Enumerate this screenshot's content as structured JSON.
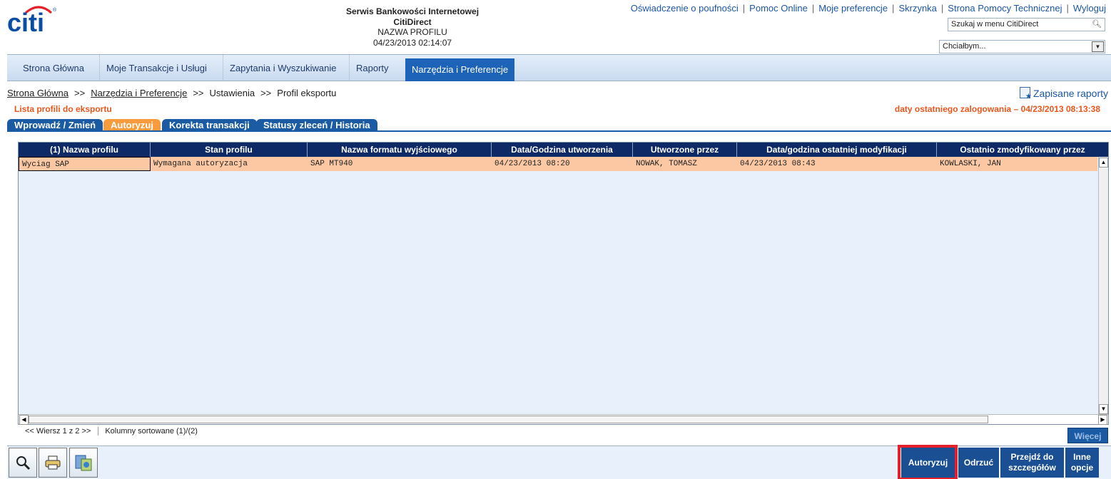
{
  "header": {
    "brand": "citi",
    "service_title": "Serwis Bankowości Internetowej",
    "service_name": "CitiDirect",
    "profile_name": "NAZWA PROFILU",
    "datetime": "04/23/2013 02:14:07",
    "links": [
      "Oświadczenie o poufności",
      "Pomoc Online",
      "Moje preferencje",
      "Skrzynka",
      "Strona Pomocy Technicznej",
      "Wyloguj"
    ],
    "search_placeholder": "Szukaj w menu CitiDirect",
    "want_select": "Chciałbym..."
  },
  "nav": {
    "items": [
      "Strona Główna",
      "Moje Transakcje i Usługi",
      "Zapytania i Wyszukiwanie",
      "Raporty",
      "Narzędzia i Preferencje"
    ],
    "active": "Narzędzia i Preferencje"
  },
  "breadcrumb": {
    "items": [
      "Strona Główna",
      "Narzędzia i Preferencje",
      "Ustawienia",
      "Profil eksportu"
    ],
    "separator": ">>"
  },
  "saved_reports": "Zapisane raporty",
  "section_title": "Lista profili do eksportu",
  "last_login": "daty ostatniego zalogowania – 04/23/2013 08:13:38",
  "tabs": [
    "Wprowadź / Zmień",
    "Autoryzuj",
    "Korekta transakcji",
    "Statusy zleceń / Historia"
  ],
  "active_tab": "Autoryzuj",
  "grid": {
    "columns": [
      "(1) Nazwa profilu",
      "Stan profilu",
      "Nazwa formatu wyjściowego",
      "Data/Godzina utworzenia",
      "Utworzone przez",
      "Data/godzina ostatniej modyfikacji",
      "Ostatnio zmodyfikowany przez"
    ],
    "rows": [
      [
        "Wyciag SAP",
        "Wymagana autoryzacja",
        "SAP MT940",
        "04/23/2013 08:20",
        "NOWAK, TOMASZ",
        "04/23/2013 08:43",
        "KOWLASKI, JAN"
      ]
    ]
  },
  "footer": {
    "paging": "<< Wiersz 1 z 2 >>",
    "sorted": "Kolumny sortowane (1)/(2)",
    "more": "Więcej"
  },
  "actions": {
    "tools": [
      "search-icon",
      "print-icon",
      "export-icon"
    ],
    "authorize": "Autoryzuj",
    "reject": "Odrzuć",
    "details_line1": "Przejdź do",
    "details_line2": "szczegółów",
    "other_line1": "Inne",
    "other_line2": "opcje"
  },
  "colors": {
    "brand_blue": "#1b57a6",
    "nav_active": "#1d63b8",
    "accent_orange": "#e8561c",
    "tab_active": "#f79b3c",
    "grid_header": "#0e2a66",
    "row_selected": "#fbc8a3",
    "highlight_red": "#e4212a"
  }
}
